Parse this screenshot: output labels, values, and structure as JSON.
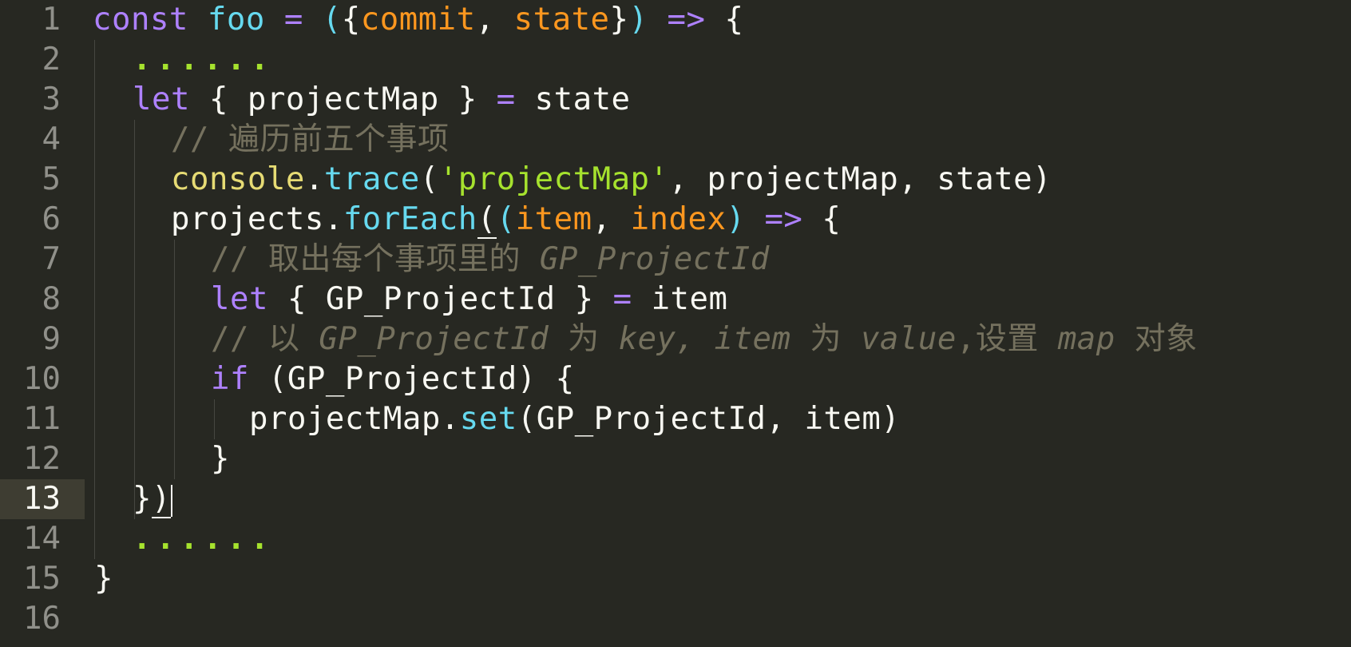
{
  "editor": {
    "language": "JavaScript",
    "theme": "Monokai",
    "cursor_line": 13
  },
  "line_numbers": [
    "1",
    "2",
    "3",
    "4",
    "5",
    "6",
    "7",
    "8",
    "9",
    "10",
    "11",
    "12",
    "13",
    "14",
    "15",
    "16"
  ],
  "code": {
    "l1": {
      "kw": "const",
      "name": "foo",
      "eq": "=",
      "open": "(",
      "brace": "{",
      "p1": "commit",
      "comma": ",",
      "p2": "state",
      "cbrace": "}",
      "close": ")",
      "arrow": "=>",
      "ob": "{"
    },
    "l2": {
      "dots": "......"
    },
    "l3": {
      "kw": "let",
      "rest1": "{ projectMap }",
      "eq": "=",
      "rest2": "state"
    },
    "l4": {
      "comment": "// 遍历前五个事项"
    },
    "l5": {
      "obj": "console",
      "dot": ".",
      "fn": "trace",
      "open": "(",
      "str": "'projectMap'",
      "rest": ", projectMap, state)"
    },
    "l6": {
      "obj": "projects",
      "dot": ".",
      "fn": "forEach",
      "open": "(",
      "popen": "(",
      "p1": "item",
      "comma": ",",
      "p2": "index",
      "pclose": ")",
      "arrow": "=>",
      "ob": "{"
    },
    "l7": {
      "comment": "// 取出每个事项里的 ",
      "comment_it": "GP_ProjectId"
    },
    "l8": {
      "kw": "let",
      "rest1": "{ GP_ProjectId }",
      "eq": "=",
      "rest2": "item"
    },
    "l9": {
      "c1": "// 以 ",
      "c2": "GP_ProjectId",
      "c3": " 为 ",
      "c4": "key, item",
      "c5": " 为 ",
      "c6": "value",
      "c7": ",设置 ",
      "c8": "map",
      "c9": " 对象"
    },
    "l10": {
      "kw": "if",
      "rest": "(GP_ProjectId) {"
    },
    "l11": {
      "obj": "projectMap",
      "dot": ".",
      "fn": "set",
      "rest": "(GP_ProjectId, item)"
    },
    "l12": {
      "text": "}"
    },
    "l13": {
      "text1": "}",
      "text2": ")"
    },
    "l14": {
      "dots": "......"
    },
    "l15": {
      "text": "}"
    },
    "l16": {
      "text": ""
    }
  }
}
